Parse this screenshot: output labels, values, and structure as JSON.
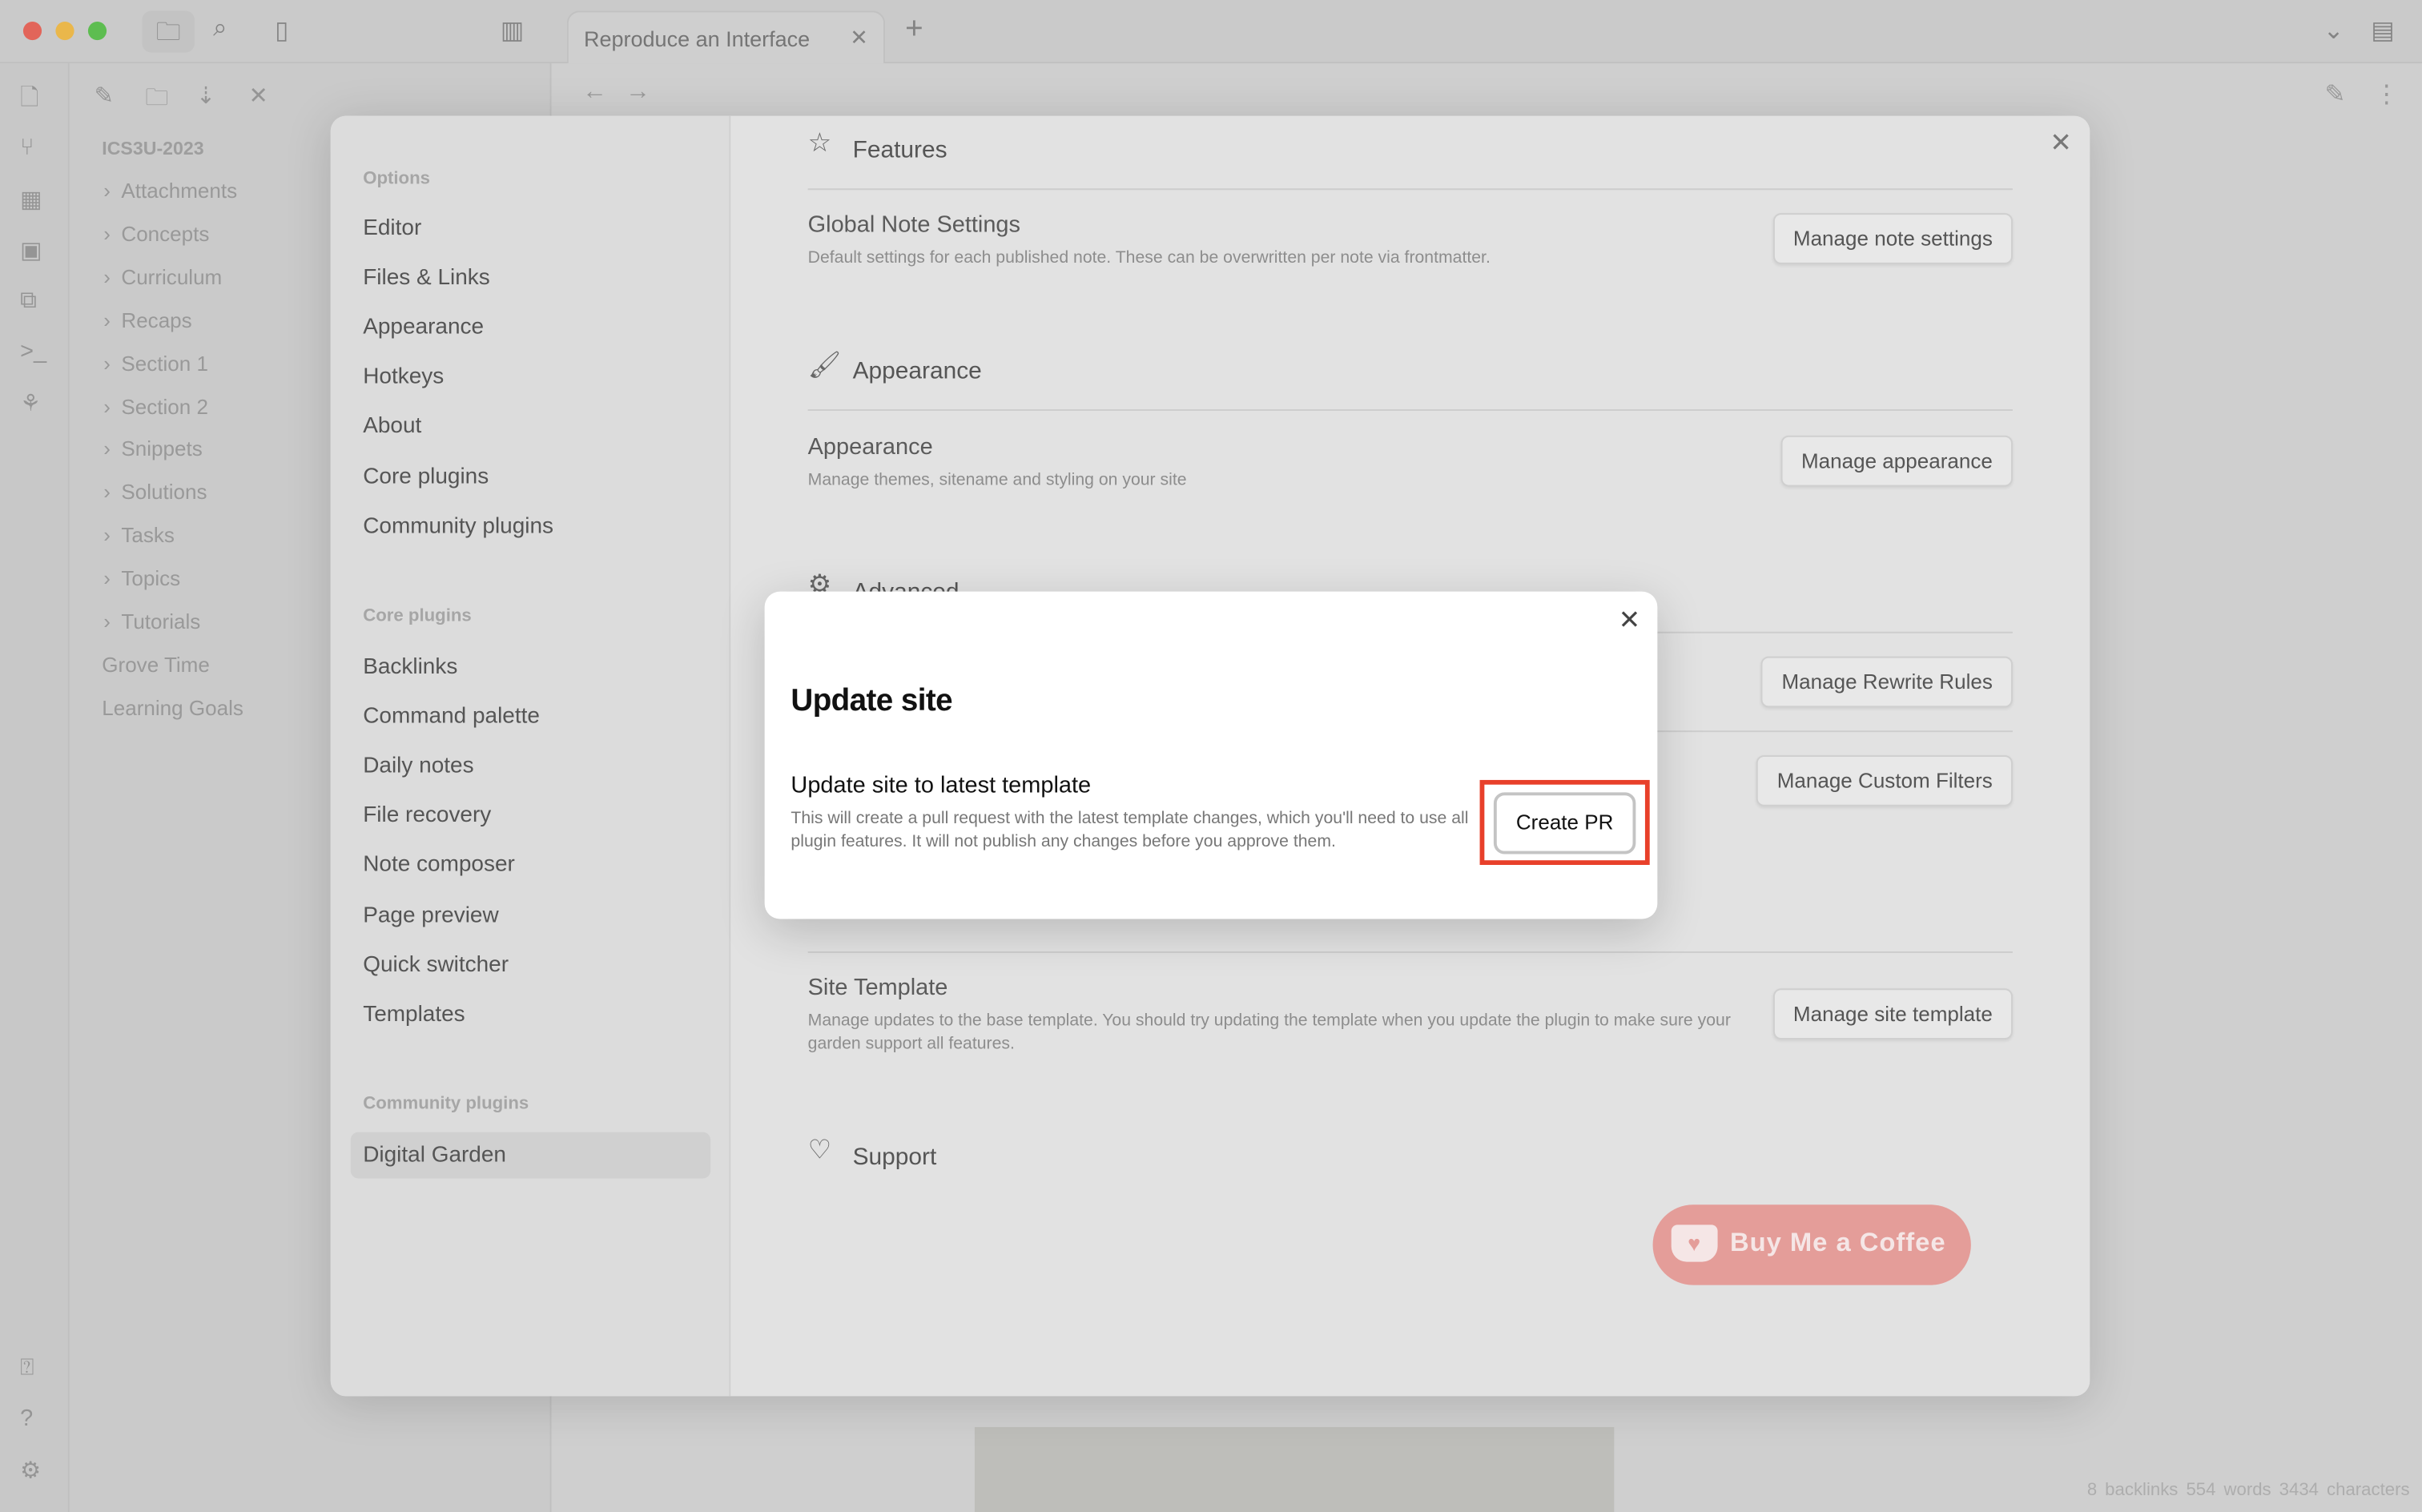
{
  "window": {
    "tab_title": "Reproduce an Interface",
    "colors": {
      "close": "#ec6a5e",
      "minimize": "#f4bf4f",
      "zoom": "#61c554",
      "accent": "#e8402a"
    }
  },
  "toolbar_icons": [
    "folder-icon",
    "search-icon",
    "file-icon",
    "sidebar-toggle-icon",
    "close-icon",
    "plus-icon",
    "chevron-down-icon",
    "right-sidebar-icon"
  ],
  "explorer": {
    "vault": "ICS3U-2023",
    "folders": [
      "Attachments",
      "Concepts",
      "Curriculum",
      "Recaps",
      "Section 1",
      "Section 2",
      "Snippets",
      "Solutions",
      "Tasks",
      "Topics",
      "Tutorials"
    ],
    "files": [
      "Grove Time",
      "Learning Goals"
    ]
  },
  "settings": {
    "options_header": "Options",
    "options": [
      "Editor",
      "Files & Links",
      "Appearance",
      "Hotkeys",
      "About",
      "Core plugins",
      "Community plugins"
    ],
    "core_header": "Core plugins",
    "core": [
      "Backlinks",
      "Command palette",
      "Daily notes",
      "File recovery",
      "Note composer",
      "Page preview",
      "Quick switcher",
      "Templates"
    ],
    "community_header": "Community plugins",
    "community": [
      "Digital Garden"
    ],
    "sections": {
      "features": "Features",
      "global_name": "Global Note Settings",
      "global_desc": "Default settings for each published note. These can be overwritten per note via frontmatter.",
      "global_btn": "Manage note settings",
      "appearance": "Appearance",
      "appearance_name": "Appearance",
      "appearance_desc": "Manage themes, sitename and styling on your site",
      "appearance_btn": "Manage appearance",
      "advanced": "Advanced",
      "rewrite_btn": "Manage Rewrite Rules",
      "filters_btn": "Manage Custom Filters",
      "template_name": "Site Template",
      "template_desc": "Manage updates to the base template. You should try updating the template when you update the plugin to make sure your garden support all features.",
      "template_btn": "Manage site template",
      "support": "Support",
      "coffee": "Buy Me a Coffee"
    }
  },
  "dialog": {
    "title": "Update site",
    "setting_name": "Update site to latest template",
    "setting_desc": "This will create a pull request with the latest template changes, which you'll need to use all plugin features. It will not publish any changes before you approve them.",
    "button": "Create PR"
  },
  "status": {
    "backlinks": "8 backlinks",
    "words": "554 words",
    "characters": "3434 characters"
  }
}
